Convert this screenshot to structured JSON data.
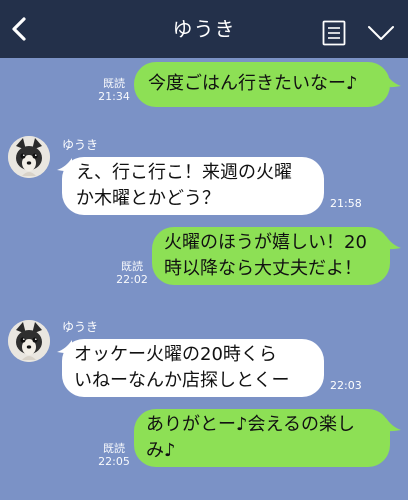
{
  "header": {
    "title": "ゆうき",
    "back_icon": "chevron-left-icon",
    "memo_icon": "memo-list-icon",
    "menu_icon": "chevron-down-icon"
  },
  "messages": [
    {
      "direction": "out",
      "text": "今度ごはん行きたいなー♪",
      "read_label": "既読",
      "time": "21:34"
    },
    {
      "direction": "in",
      "sender": "ゆうき",
      "text_line1": "え、行こ行こ！来週の火曜",
      "text_line2": "か木曜とかどう？",
      "time": "21:58"
    },
    {
      "direction": "out",
      "text_line1": "火曜のほうが嬉しい！20",
      "text_line2": "時以降なら大丈夫だよ！",
      "read_label": "既読",
      "time": "22:02"
    },
    {
      "direction": "in",
      "sender": "ゆうき",
      "text_line1": "オッケー火曜の20時くら",
      "text_line2": "いねーなんか店探しとくー",
      "time": "22:03"
    },
    {
      "direction": "out",
      "text_line1": "ありがとー♪会えるの楽し",
      "text_line2": "み♪",
      "read_label": "既読",
      "time": "22:05"
    }
  ],
  "colors": {
    "background": "#7b92c6",
    "header": "#23304a",
    "outgoing_bubble": "#8de055",
    "incoming_bubble": "#ffffff"
  }
}
